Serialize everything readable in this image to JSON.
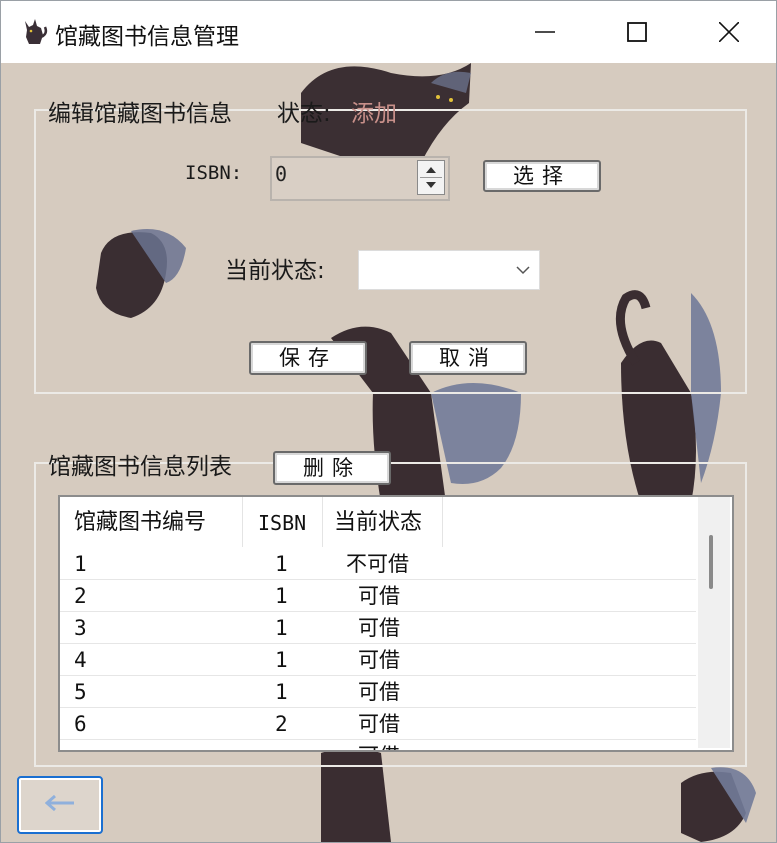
{
  "window": {
    "title": "馆藏图书信息管理",
    "icon": "black-cat-icon"
  },
  "edit_group": {
    "legend": "编辑馆藏图书信息",
    "status_label": "状态:",
    "status_value": "添加",
    "isbn_label": "ISBN:",
    "isbn_value": "0",
    "select_button": "选择",
    "current_status_label": "当前状态:",
    "current_status_value": "",
    "save_button": "保存",
    "cancel_button": "取消"
  },
  "list_group": {
    "legend": "馆藏图书信息列表",
    "delete_button": "删除",
    "columns": [
      "馆藏图书编号",
      "ISBN",
      "当前状态"
    ],
    "rows": [
      {
        "id": "1",
        "isbn": "1",
        "status": "不可借"
      },
      {
        "id": "2",
        "isbn": "1",
        "status": "可借"
      },
      {
        "id": "3",
        "isbn": "1",
        "status": "可借"
      },
      {
        "id": "4",
        "isbn": "1",
        "status": "可借"
      },
      {
        "id": "5",
        "isbn": "1",
        "status": "可借"
      },
      {
        "id": "6",
        "isbn": "2",
        "status": "可借"
      },
      {
        "id": "",
        "isbn": "",
        "status": "可借"
      }
    ]
  },
  "back_button_icon": "arrow-left-icon",
  "colors": {
    "background": "#d6cbbf",
    "status_value": "#c8908a",
    "focus_border": "#1a6fd1",
    "back_arrow": "#8fb0dc"
  }
}
